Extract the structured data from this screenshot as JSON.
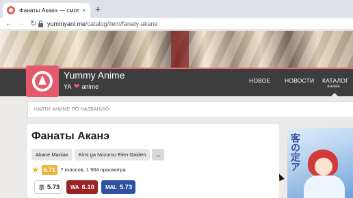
{
  "browser": {
    "tab_title": "Фанаты Аканэ — смотреть онлайн",
    "tab_close": "×",
    "new_tab": "+",
    "back": "←",
    "forward": "→",
    "reload": "↻",
    "url_host": "yummyani.me",
    "url_path": "/catalog/item/fanaty-akane"
  },
  "site": {
    "name": "Yummy Anime",
    "tagline_left": "YA",
    "heart": "❤",
    "tagline_right": "anime",
    "accent_color": "#e4596b",
    "nav": {
      "new": "НОВОЕ",
      "news": "НОВОСТИ",
      "catalog": "КАТАЛОГ",
      "catalog_sub": "аниме"
    }
  },
  "search": {
    "placeholder": "НАЙТИ АНИМЕ ПО НАЗВАНИЮ"
  },
  "anime": {
    "title": "Фанаты Аканэ",
    "alt_titles": [
      "Akane Maniax",
      "Kimi ga Nozomu Eien Gaiden",
      "..."
    ],
    "star": "★",
    "rating": "6.71",
    "rating_meta": "7 голосов, 1 904 просмотра",
    "scores": {
      "shiki_logo": "示",
      "shiki": "5.73",
      "wa_logo": "WA",
      "wa": "6.10",
      "mal_logo": "MAL",
      "mal": "5.73"
    },
    "poster_text": "客の定ア"
  }
}
